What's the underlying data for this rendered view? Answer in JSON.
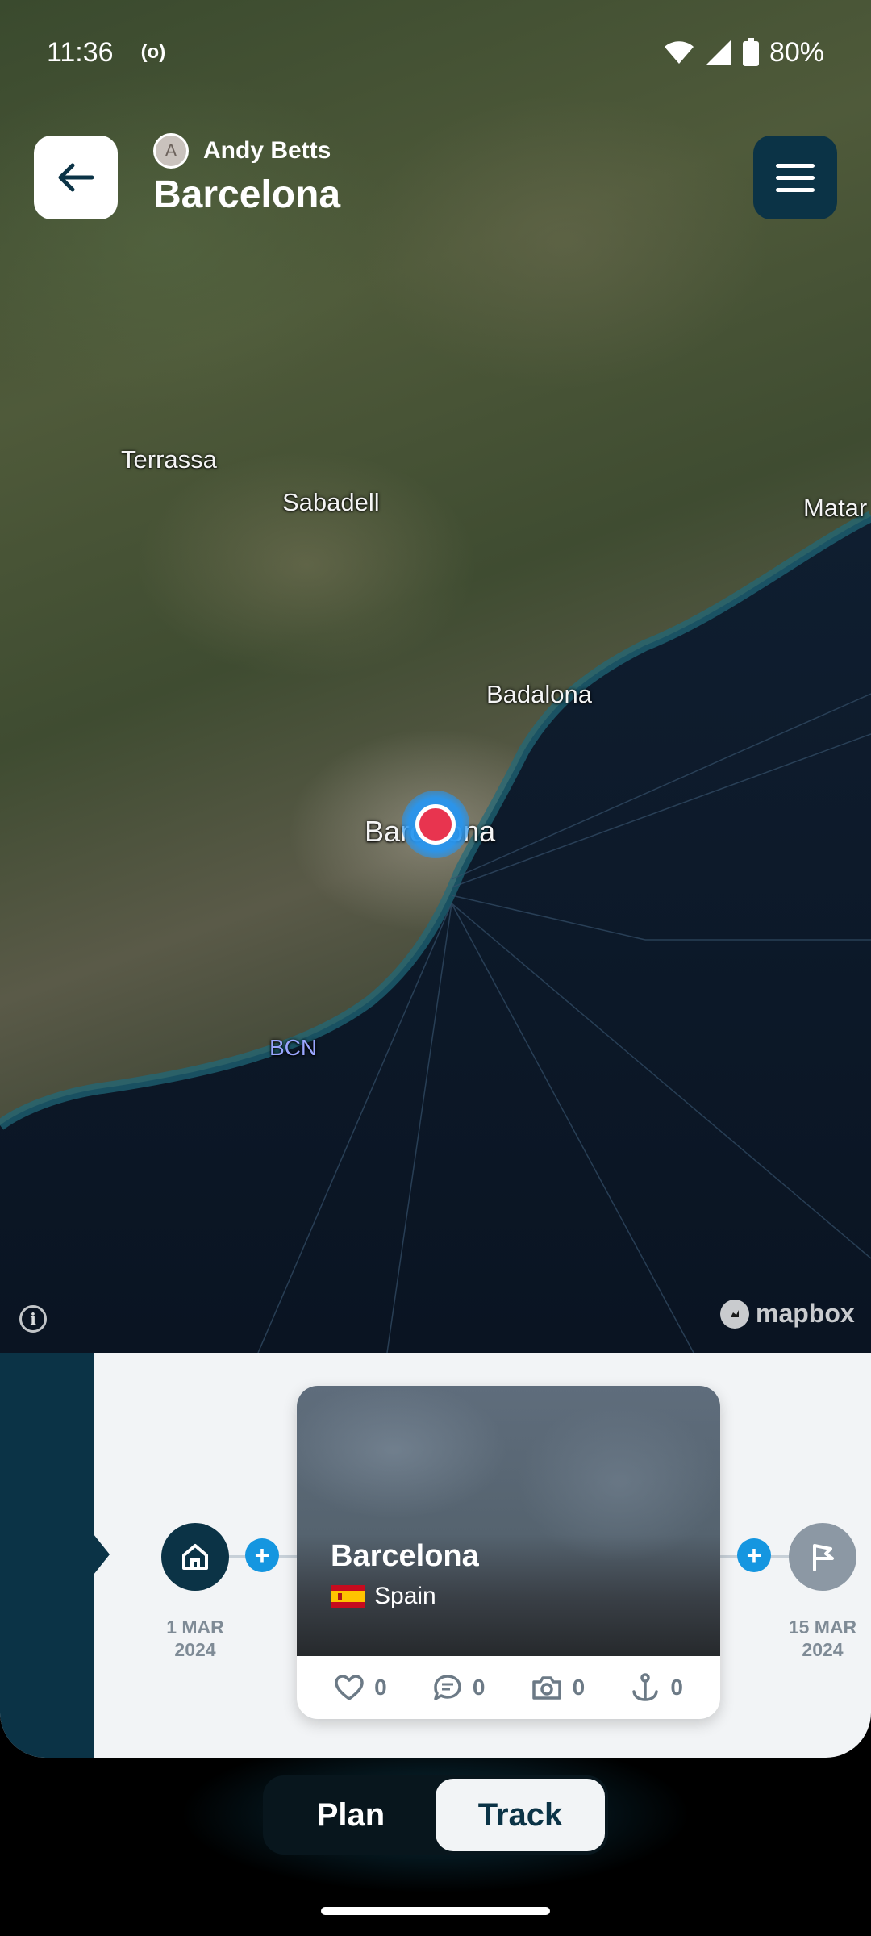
{
  "status_bar": {
    "time": "11:36",
    "hotspot_indicator": "(o)",
    "battery": "80%",
    "icons": [
      "wifi-icon",
      "signal-icon",
      "battery-icon"
    ]
  },
  "header": {
    "owner_initial": "A",
    "owner_name": "Andy Betts",
    "title": "Barcelona",
    "back_icon": "arrow-left-icon",
    "menu_icon": "hamburger-menu-icon"
  },
  "map": {
    "labels": {
      "terrassa": "Terrassa",
      "sabadell": "Sabadell",
      "mataro": "Matar",
      "badalona": "Badalona",
      "barcelona": "Barcelona",
      "bcn": "BCN"
    },
    "attribution": "mapbox",
    "info_icon": "i"
  },
  "timeline": {
    "start": {
      "icon": "home-icon",
      "date_line1": "1 MAR",
      "date_line2": "2024"
    },
    "end": {
      "icon": "flag-icon",
      "date_line1": "15 MAR",
      "date_line2": "2024"
    },
    "add_stop_label": "+",
    "stop": {
      "name": "Barcelona",
      "country": "Spain",
      "stats": {
        "likes": "0",
        "comments": "0",
        "photos": "0",
        "anchors": "0"
      }
    }
  },
  "nav": {
    "tabs": {
      "plan": "Plan",
      "track": "Track"
    },
    "active": "Track"
  },
  "colors": {
    "navy": "#0b3346",
    "accent_blue": "#1596e0",
    "pin_red": "#e8344f",
    "panel_bg": "#f2f4f6"
  }
}
